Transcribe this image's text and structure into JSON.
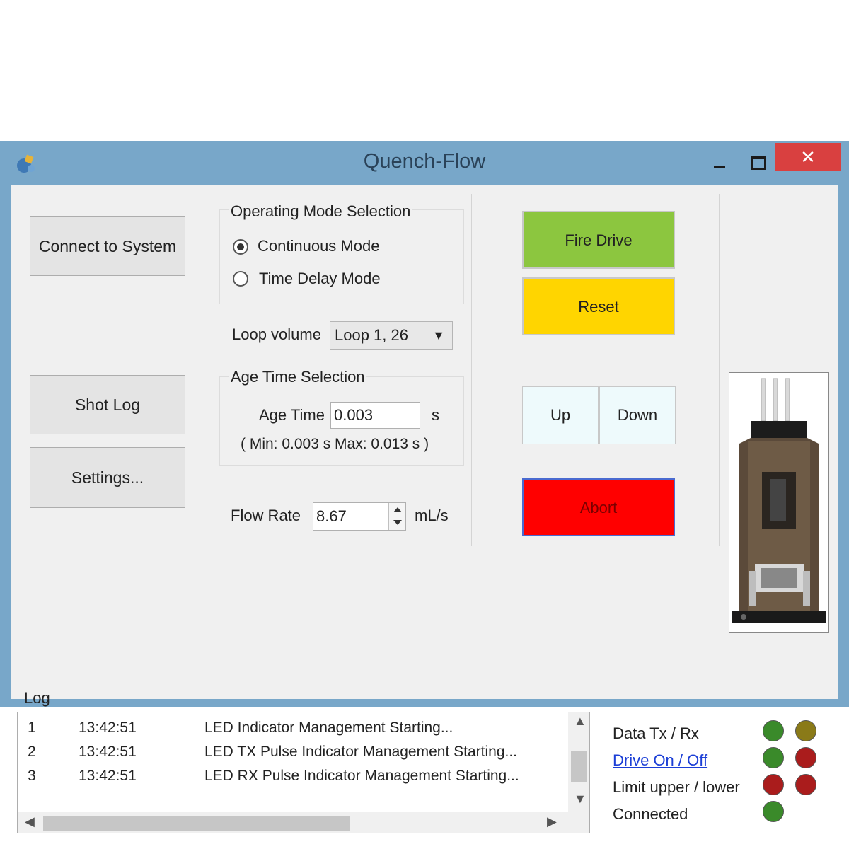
{
  "window": {
    "title": "Quench-Flow",
    "close_glyph": "✕"
  },
  "left": {
    "connect_label": "Connect to System",
    "shotlog_label": "Shot Log",
    "settings_label": "Settings..."
  },
  "mode": {
    "group_title": "Operating Mode Selection",
    "options": [
      "Continuous Mode",
      "Time Delay Mode"
    ],
    "selected": "Continuous Mode"
  },
  "loop": {
    "label": "Loop volume",
    "value": "Loop 1, 26"
  },
  "age": {
    "group_title": "Age Time Selection",
    "label": "Age Time",
    "value": "0.003",
    "unit": "s",
    "range_text": "( Min: 0.003 s    Max: 0.013 s )"
  },
  "flow": {
    "label": "Flow Rate",
    "value": "8.67",
    "unit": "mL/s"
  },
  "controls": {
    "fire_label": "Fire Drive",
    "reset_label": "Reset",
    "up_label": "Up",
    "down_label": "Down",
    "abort_label": "Abort",
    "colors": {
      "fire": "#8cc63f",
      "reset": "#ffd500",
      "abort": "#ff0000",
      "updown": "#eefafc"
    }
  },
  "log": {
    "title": "Log",
    "rows": [
      {
        "n": "1",
        "time": "13:42:51",
        "msg": "LED Indicator Management Starting..."
      },
      {
        "n": "2",
        "time": "13:42:51",
        "msg": "LED TX Pulse Indicator Management Starting..."
      },
      {
        "n": "3",
        "time": "13:42:51",
        "msg": "LED RX Pulse Indicator Management Starting..."
      }
    ]
  },
  "status": {
    "items": [
      {
        "label": "Data Tx / Rx",
        "leds": [
          "#3a8a2a",
          "#8a7a18"
        ]
      },
      {
        "label": "Drive On / Off",
        "leds": [
          "#3a8a2a",
          "#aa1c1c"
        ],
        "link": true
      },
      {
        "label": "Limit upper / lower",
        "leds": [
          "#aa1c1c",
          "#aa1c1c"
        ]
      },
      {
        "label": "Connected",
        "leds": [
          "#3a8a2a"
        ]
      }
    ]
  }
}
